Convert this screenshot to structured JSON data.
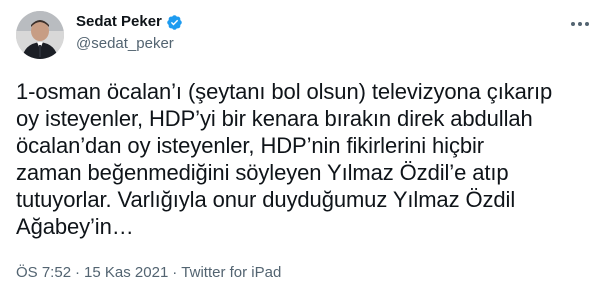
{
  "author": {
    "name": "Sedat Peker",
    "handle": "@sedat_peker",
    "verified": true
  },
  "tweet": {
    "text": "1-osman öcalan’ı (şeytanı bol olsun) televizyona çıkarıp\noy isteyenler, HDP’yi bir kenara bırakın direk abdullah\nöcalan’dan oy isteyenler, HDP’nin fikirlerini hiçbir\nzaman beğenmediğini söyleyen Yılmaz Özdil’e atıp\ntutuyorlar. Varlığıyla onur duyduğumuz Yılmaz Özdil\nAğabey’in…"
  },
  "meta": {
    "time": "ÖS 7:52",
    "sep1": "·",
    "date": "15 Kas 2021",
    "sep2": "·",
    "source": "Twitter for iPad"
  },
  "colors": {
    "verified": "#1d9bf0",
    "text_primary": "#0f1419",
    "text_secondary": "#536471"
  },
  "icons": {
    "verified": "verified-badge-icon",
    "more": "more-options-icon"
  }
}
